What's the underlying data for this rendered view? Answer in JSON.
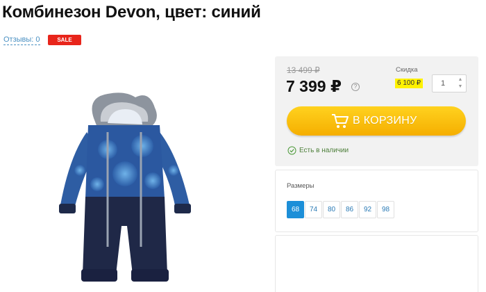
{
  "product": {
    "title": "Комбинезон Devon, цвет: синий",
    "reviews_label": "Отзывы: 0",
    "sale_badge": "SALE",
    "image_icon": "blue-snowsuit-photo"
  },
  "buy_box": {
    "old_price": "13 499 ₽",
    "price": "7 399 ₽",
    "info_icon": "?",
    "discount_label": "Скидка",
    "discount_value": "6 100 ₽",
    "quantity": "1",
    "qty_up": "▲",
    "qty_down": "▼",
    "cart_button_label": "В КОРЗИНУ",
    "stock_text": "Есть в наличии"
  },
  "sizes": {
    "label": "Размеры",
    "options": [
      {
        "label": "68",
        "selected": true
      },
      {
        "label": "74",
        "selected": false
      },
      {
        "label": "80",
        "selected": false
      },
      {
        "label": "86",
        "selected": false
      },
      {
        "label": "92",
        "selected": false
      },
      {
        "label": "98",
        "selected": false
      }
    ]
  },
  "colors": {
    "accent_blue": "#1c8fd8",
    "sale_red": "#e8251b",
    "cart_yellow": "#f5ae00",
    "discount_highlight": "#fff200",
    "stock_green": "#4d7f3a"
  }
}
